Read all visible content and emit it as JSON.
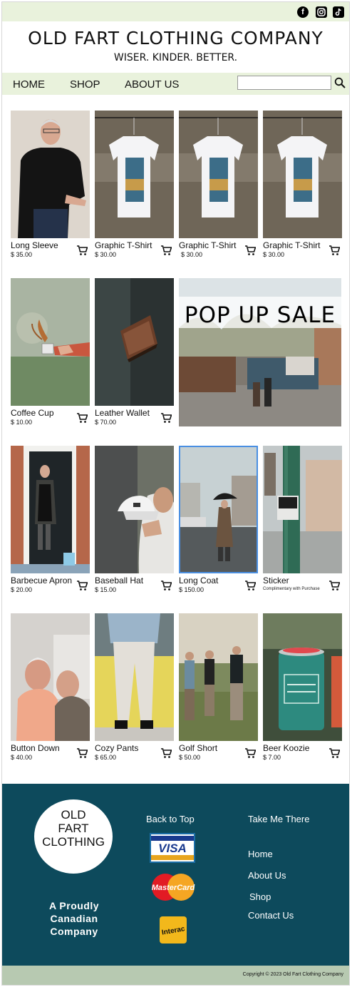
{
  "header": {
    "social_icons": [
      "facebook-icon",
      "instagram-icon",
      "tiktok-icon"
    ],
    "brand": "OLD FART CLOTHING COMPANY",
    "tagline": "WISER. KINDER. BETTER."
  },
  "nav": {
    "items": [
      "HOME",
      "SHOP",
      "ABOUT US"
    ],
    "search_placeholder": ""
  },
  "products": [
    {
      "name": "Long Sleeve",
      "price": "$ 35.00"
    },
    {
      "name": "Graphic T-Shirt",
      "price": "$ 30.00"
    },
    {
      "name": "Graphic T-Shirt",
      "price": "$ 30.00"
    },
    {
      "name": "Graphic T-Shirt",
      "price": "$ 30.00"
    },
    {
      "name": "Coffee Cup",
      "price": "$ 10.00"
    },
    {
      "name": "Leather Wallet",
      "price": "$ 70.00"
    },
    {
      "name": "Barbecue Apron",
      "price": "$ 20.00"
    },
    {
      "name": "Baseball Hat",
      "price": "$ 15.00"
    },
    {
      "name": "Long Coat",
      "price": "$ 150.00"
    },
    {
      "name": "Sticker",
      "price": "",
      "note": "Complimentary with Purchase"
    },
    {
      "name": "Button Down",
      "price": "$ 40.00"
    },
    {
      "name": "Cozy Pants",
      "price": "$ 65.00"
    },
    {
      "name": "Golf Short",
      "price": "$ 50.00"
    },
    {
      "name": "Beer Koozie",
      "price": "$ 7.00"
    }
  ],
  "promo": {
    "text": "POP UP SALE"
  },
  "footer": {
    "logo_lines": [
      "OLD",
      "FART",
      "CLOTHING"
    ],
    "slogan": [
      "A Proudly",
      "Canadian",
      "Company"
    ],
    "back_to_top": "Back to Top",
    "links_heading": "Take Me There",
    "links": [
      "Home",
      "About Us",
      "Shop",
      "Contact Us"
    ],
    "payments": [
      "VISA",
      "MasterCard",
      "Interac"
    ],
    "copyright": "Copyright © 2023 Old Fart Clothing Company"
  },
  "colors": {
    "accent_bar": "#e9f2dc",
    "footer_bg": "#0d4a5c",
    "copyright_bar": "#b7c9b1"
  }
}
